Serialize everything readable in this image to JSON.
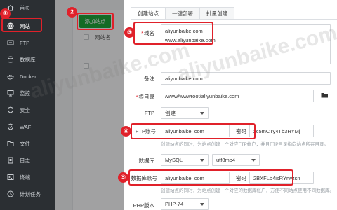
{
  "sidebar": {
    "items": [
      {
        "label": "首页",
        "icon": "home-icon"
      },
      {
        "label": "网站",
        "icon": "globe-icon"
      },
      {
        "label": "FTP",
        "icon": "ftp-icon"
      },
      {
        "label": "数据库",
        "icon": "database-icon"
      },
      {
        "label": "Docker",
        "icon": "docker-icon"
      },
      {
        "label": "监控",
        "icon": "monitor-icon"
      },
      {
        "label": "安全",
        "icon": "shield-icon"
      },
      {
        "label": "WAF",
        "icon": "waf-icon"
      },
      {
        "label": "文件",
        "icon": "folder-icon"
      },
      {
        "label": "日志",
        "icon": "log-icon"
      },
      {
        "label": "终端",
        "icon": "terminal-icon"
      },
      {
        "label": "计划任务",
        "icon": "clock-icon"
      }
    ],
    "active_index": 1
  },
  "site_list": {
    "add_button": "添加站点",
    "column_site_name": "网站名"
  },
  "steps": [
    "①",
    "②",
    "③",
    "④",
    "⑤"
  ],
  "dialog": {
    "tabs": [
      "创建站点",
      "一键部署",
      "批量创建"
    ],
    "domain": {
      "label": "域名",
      "lines": [
        "aliyunbaike.com",
        "www.aliyunbaike.com"
      ]
    },
    "remark": {
      "label": "备注",
      "value": "aliyunbaike.com"
    },
    "root": {
      "label": "根目录",
      "value": "/www/wwwroot/aliyunbaike.com"
    },
    "ftp": {
      "label": "FTP",
      "value": "创建"
    },
    "ftp_account": {
      "label": "FTP账号",
      "user": "aliyunbaike_com",
      "password_label": "密码",
      "password": "zc5mCTy4Tb3RYMj",
      "hint": "创建站点的同时，为站点创建一个对应FTP帐户，并且FTP目录指向站点所在目录。"
    },
    "database": {
      "label": "数据库",
      "type": "MySQL",
      "charset": "utf8mb4"
    },
    "db_account": {
      "label": "数据库账号",
      "user": "aliyunbaike_com",
      "password_label": "密码",
      "password": "2BXFLb4isRYrwzsn",
      "hint": "创建站点的同时，为站点创建一个对应的数据库帐户，方便不同站点使用不同数据库。"
    },
    "php": {
      "label": "PHP版本",
      "value": "PHP-74"
    }
  },
  "watermark": "aliyunbaike.com",
  "colors": {
    "accent_red": "#e0212a",
    "brand_green": "#20a53a",
    "sidebar_bg": "#2b2f33"
  }
}
